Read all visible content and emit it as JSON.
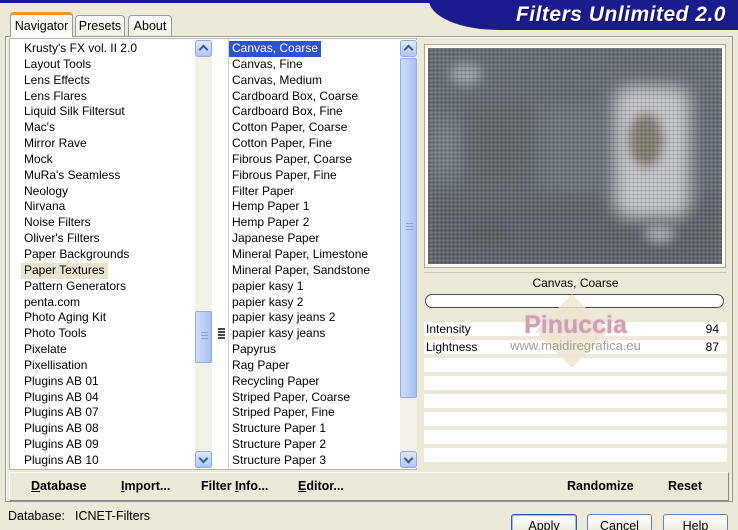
{
  "banner": {
    "title": "Filters Unlimited 2.0"
  },
  "tabs": {
    "navigator": "Navigator",
    "presets": "Presets",
    "about": "About"
  },
  "navigator_panel": {
    "categories": [
      "Krusty's FX vol. II 2.0",
      "Layout Tools",
      "Lens Effects",
      "Lens Flares",
      "Liquid Silk Filtersut",
      "Mac's",
      "Mirror Rave",
      "Mock",
      "MuRa's Seamless",
      "Neology",
      "Nirvana",
      "Noise Filters",
      "Oliver's Filters",
      "Paper Backgrounds",
      "Paper Textures",
      "Pattern Generators",
      "penta.com",
      "Photo Aging Kit",
      "Photo Tools",
      "Pixelate",
      "Pixellisation",
      "Plugins AB 01",
      "Plugins AB 04",
      "Plugins AB 07",
      "Plugins AB 08",
      "Plugins AB 09",
      "Plugins AB 10"
    ],
    "selected_index": 14,
    "selected": "Paper Textures"
  },
  "filters_panel": {
    "filters": [
      "Canvas, Coarse",
      "Canvas, Fine",
      "Canvas, Medium",
      "Cardboard Box, Coarse",
      "Cardboard Box, Fine",
      "Cotton Paper, Coarse",
      "Cotton Paper, Fine",
      "Fibrous Paper, Coarse",
      "Fibrous Paper, Fine",
      "Filter Paper",
      "Hemp Paper 1",
      "Hemp Paper 2",
      "Japanese Paper",
      "Mineral Paper, Limestone",
      "Mineral Paper, Sandstone",
      "papier kasy 1",
      "papier kasy 2",
      "papier kasy jeans 2",
      "papier kasy jeans",
      "Papyrus",
      "Rag Paper",
      "Recycling Paper",
      "Striped Paper, Coarse",
      "Striped Paper, Fine",
      "Structure Paper 1",
      "Structure Paper 2",
      "Structure Paper 3"
    ],
    "selected_index": 0,
    "selected": "Canvas, Coarse",
    "grip_index": 18,
    "grip_icon": "drag-grip-icon"
  },
  "preview": {
    "caption": "Canvas, Coarse",
    "watermark_name": "Pinuccia",
    "watermark_url": "www.maidiregrafica.eu"
  },
  "controls": {
    "sliders": [
      {
        "label": "Intensity",
        "value": "94"
      },
      {
        "label": "Lightness",
        "value": "87"
      }
    ],
    "empty_rows": 6
  },
  "toolbar": {
    "items": [
      {
        "pre": "",
        "u": "D",
        "post": "atabase"
      },
      {
        "pre": "",
        "u": "I",
        "post": "mport..."
      },
      {
        "pre": "Filter ",
        "u": "I",
        "post": "nfo..."
      },
      {
        "pre": "",
        "u": "E",
        "post": "ditor..."
      }
    ],
    "randomize": "Randomize",
    "reset": "Reset"
  },
  "statusbar": {
    "label": "Database:",
    "value": "ICNET-Filters"
  },
  "dialog_buttons": {
    "apply": "Apply",
    "cancel": "Cancel",
    "help": "Help"
  },
  "colors": {
    "background": "#ece9d8",
    "banner_navy": "#1b1b8e",
    "selection_blue": "#2b55c8",
    "inactive_selection": "#e9e4cd",
    "tab_accent_orange": "#e8972e",
    "watermark_pink": "#cf9fb4"
  },
  "icons": [
    "chevron-up-icon",
    "chevron-down-icon",
    "drag-grip-icon",
    "thumb-grip-icon"
  ]
}
